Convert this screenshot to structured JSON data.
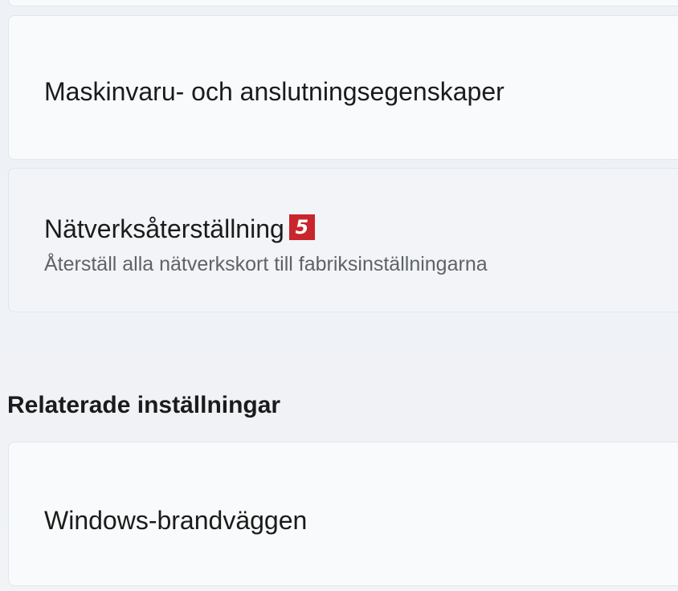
{
  "cards": {
    "hardware": {
      "title": "Maskinvaru- och anslutningsegenskaper"
    },
    "network_reset": {
      "title": "Nätverksåterställning",
      "badge": "5",
      "description": "Återställ alla nätverkskort till fabriksinställningarna"
    },
    "firewall": {
      "title": "Windows-brandväggen"
    }
  },
  "related": {
    "heading": "Relaterade inställningar"
  },
  "colors": {
    "badge": "#c9252c",
    "background": "#eef1f5",
    "card": "#f9fafc"
  }
}
